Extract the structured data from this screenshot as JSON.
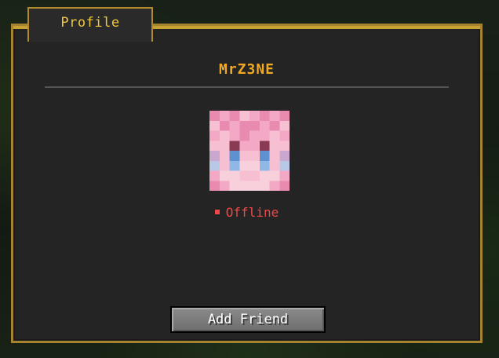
{
  "tab": {
    "label": "Profile"
  },
  "profile": {
    "name": "MrZ3NE",
    "status": "Offline"
  },
  "actions": {
    "add_friend_label": "Add Friend"
  },
  "colors": {
    "accent_gold": "#c8a233",
    "name_orange": "#f2a922",
    "status_red": "#f04848",
    "panel_bg": "#242424",
    "button_gray": "#7c7c7c"
  },
  "icons": {
    "avatar": "player-head-icon",
    "status_dot": "status-dot-icon"
  }
}
